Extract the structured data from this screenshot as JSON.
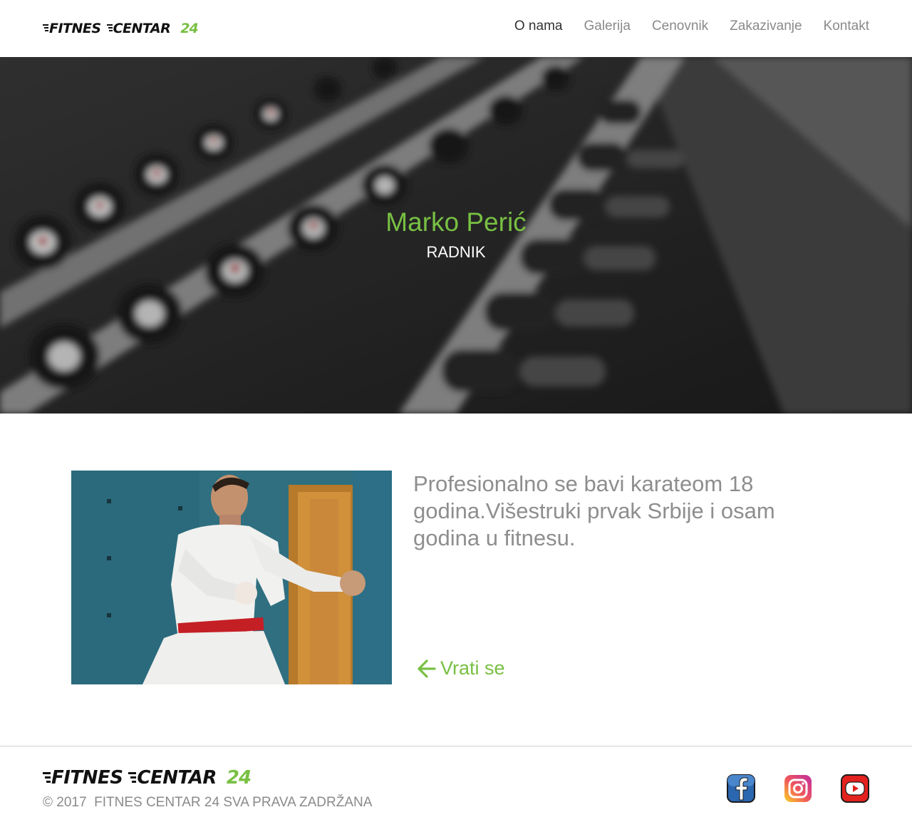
{
  "colors": {
    "accent": "#78c043",
    "nav_text": "#8a8a8a",
    "nav_active": "#333333",
    "body_text": "#8e8e8e"
  },
  "header": {
    "logo": {
      "word1": "FITNES",
      "word2": "CENTAR",
      "number": "24"
    },
    "nav": [
      {
        "label": "O nama",
        "active": true
      },
      {
        "label": "Galerija",
        "active": false
      },
      {
        "label": "Cenovnik",
        "active": false
      },
      {
        "label": "Zakazivanje",
        "active": false
      },
      {
        "label": "Kontakt",
        "active": false
      }
    ]
  },
  "hero": {
    "name": "Marko Perić",
    "role": "RADNIK"
  },
  "profile": {
    "bio": "Profesionalno se bavi karateom 18 godina.Višestruki prvak Srbije i osam godina u fitnesu.",
    "back_label": "Vrati se",
    "back_icon": "arrow-left-icon"
  },
  "footer": {
    "logo": {
      "word1": "FITNES",
      "word2": "CENTAR",
      "number": "24"
    },
    "copyright": "© 2017  FITNES CENTAR 24 SVA PRAVA ZADRŽANA",
    "social": [
      "facebook-icon",
      "instagram-icon",
      "youtube-icon"
    ]
  }
}
